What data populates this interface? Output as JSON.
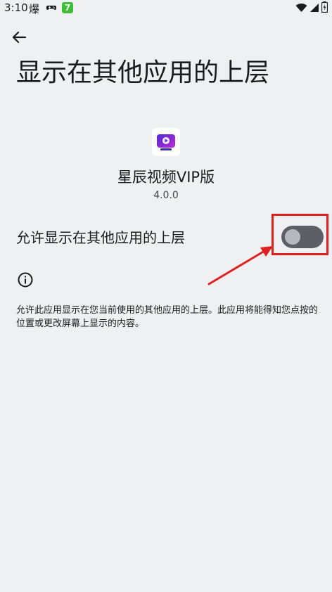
{
  "status_bar": {
    "time": "3:10",
    "notif_char": "爆",
    "app_badge": "7",
    "icons": [
      "gamepad-icon",
      "app-seven-icon",
      "wifi-icon",
      "signal-icon",
      "battery-icon"
    ]
  },
  "header": {
    "back_icon": "back-arrow-icon",
    "title": "显示在其他应用的上层"
  },
  "app": {
    "name": "星辰视频VIP版",
    "version": "4.0.0"
  },
  "setting": {
    "label": "允许显示在其他应用的上层",
    "toggle_on": false
  },
  "info": {
    "icon": "info-icon",
    "description": "允许此应用显示在您当前使用的其他应用的上层。此应用将能得知您点按的位置或更改屏幕上显示的内容。"
  },
  "colors": {
    "background": "#eff0f2",
    "toggle_track": "#5e5f66",
    "toggle_thumb": "#b8b9bf",
    "annotation": "#e02020"
  }
}
